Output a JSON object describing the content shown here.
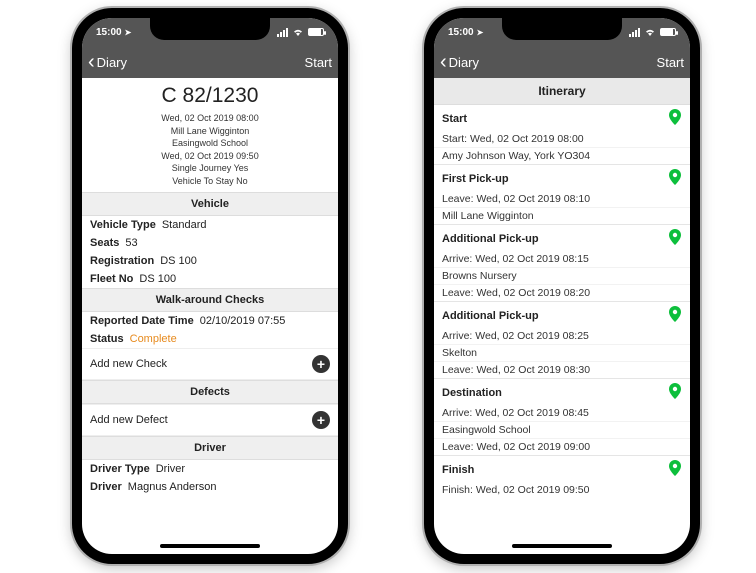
{
  "status_bar": {
    "time": "15:00"
  },
  "nav": {
    "back": "Diary",
    "action": "Start"
  },
  "phone1": {
    "job_code": "C 82/1230",
    "meta": [
      "Wed, 02 Oct 2019 08:00",
      "Mill Lane Wigginton",
      "Easingwold School",
      "Wed, 02 Oct 2019 09:50",
      "Single Journey  Yes",
      "Vehicle To Stay  No"
    ],
    "sections": {
      "vehicle": {
        "title": "Vehicle",
        "rows": [
          {
            "k": "Vehicle Type",
            "v": "Standard"
          },
          {
            "k": "Seats",
            "v": "53"
          },
          {
            "k": "Registration",
            "v": "DS 100"
          },
          {
            "k": "Fleet No",
            "v": "DS 100"
          }
        ]
      },
      "checks": {
        "title": "Walk-around Checks",
        "rows": [
          {
            "k": "Reported Date Time",
            "v": "02/10/2019 07:55"
          },
          {
            "k": "Status",
            "v": "Complete",
            "status": true
          }
        ],
        "add": "Add new Check"
      },
      "defects": {
        "title": "Defects",
        "add": "Add new Defect"
      },
      "driver": {
        "title": "Driver",
        "rows": [
          {
            "k": "Driver Type",
            "v": "Driver"
          },
          {
            "k": "Driver",
            "v": "Magnus Anderson"
          }
        ]
      }
    }
  },
  "phone2": {
    "header": "Itinerary",
    "stops": [
      {
        "label": "Start",
        "lines": [
          "Start: Wed, 02 Oct 2019 08:00",
          "Amy Johnson Way, York YO304"
        ]
      },
      {
        "label": "First Pick-up",
        "lines": [
          "Leave: Wed, 02 Oct 2019 08:10",
          "Mill Lane Wigginton"
        ]
      },
      {
        "label": "Additional Pick-up",
        "lines": [
          "Arrive: Wed, 02 Oct 2019 08:15",
          "Browns Nursery",
          "Leave: Wed, 02 Oct 2019 08:20"
        ]
      },
      {
        "label": "Additional Pick-up",
        "lines": [
          "Arrive: Wed, 02 Oct 2019 08:25",
          "Skelton",
          "Leave: Wed, 02 Oct 2019 08:30"
        ]
      },
      {
        "label": "Destination",
        "lines": [
          "Arrive: Wed, 02 Oct 2019 08:45",
          "Easingwold School",
          "Leave: Wed, 02 Oct 2019 09:00"
        ]
      },
      {
        "label": "Finish",
        "lines": [
          "Finish: Wed, 02 Oct 2019 09:50"
        ]
      }
    ]
  }
}
